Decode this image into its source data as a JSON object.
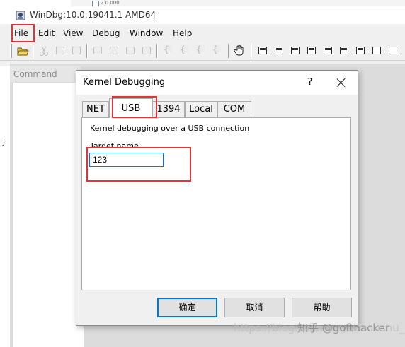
{
  "window": {
    "title": "WinDbg:10.0.19041.1 AMD64",
    "background_tab": "2.0.000"
  },
  "menu": {
    "items": [
      "File",
      "Edit",
      "View",
      "Debug",
      "Window",
      "Help"
    ]
  },
  "toolbar": {
    "icons": [
      "open-folder-icon",
      "cut-icon",
      "copy-icon",
      "paste-icon",
      "source-mode-icon",
      "step-into-icon",
      "step-over-icon",
      "step-out-icon",
      "run-to-cursor-icon",
      "braces-icon",
      "hand-icon",
      "command-window-icon",
      "watch-icon",
      "locals-icon",
      "registers-icon",
      "memory-icon",
      "call-stack-icon",
      "disassembly-icon",
      "scratch-pad-icon",
      "processes-icon"
    ]
  },
  "workspace": {
    "command_window_title": "Command",
    "edge_glyph": "J"
  },
  "dialog": {
    "title": "Kernel Debugging",
    "help_label": "?",
    "tabs": [
      "NET",
      "USB",
      "1394",
      "Local",
      "COM"
    ],
    "active_tab": "USB",
    "description": "Kernel debugging over a USB connection",
    "target_label": "Target name",
    "target_value": "123",
    "buttons": {
      "ok": "确定",
      "cancel": "取消",
      "help": "帮助"
    }
  },
  "watermark": {
    "url": "https://blog.csdn.net/fanxiushu_08",
    "zhihu": "知乎 @gofthacker"
  },
  "colors": {
    "highlight": "#e0333a",
    "focus_border": "#0078d7"
  }
}
